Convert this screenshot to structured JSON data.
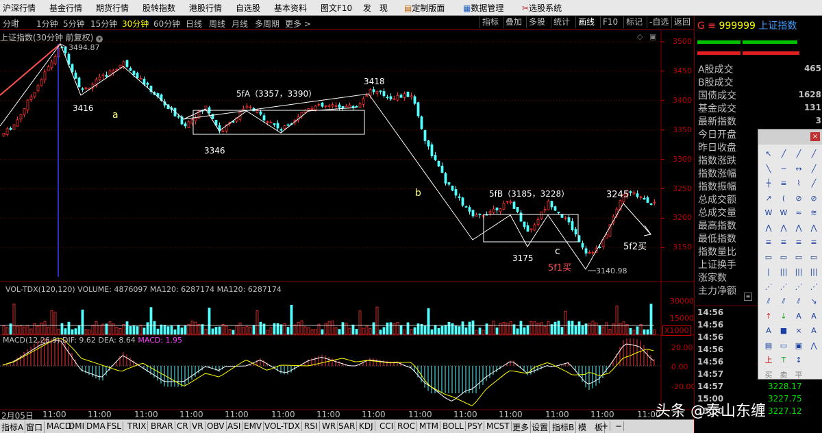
{
  "menu": [
    "沪深行情",
    "基金行情",
    "期货行情",
    "股转指数",
    "港股行情",
    "自选股",
    "基本资料",
    "图文F10",
    "发　现",
    "定制版面",
    "数据管理",
    "选股系统"
  ],
  "toolbar": {
    "periods": [
      "分时",
      "1分钟",
      "5分钟",
      "15分钟",
      "30分钟",
      "60分钟",
      "日线",
      "周线",
      "月线",
      "多周期",
      "更多 >"
    ],
    "active_period": "30分钟",
    "right_buttons": [
      "指标",
      "叠加",
      "多股",
      "统计",
      "画线",
      "F10",
      "标记",
      "-自选",
      "返回"
    ],
    "active_right": "画线"
  },
  "chart": {
    "title": "上证指数(30分钟 前复权)",
    "price_axis": [
      "3500",
      "3450",
      "3400",
      "3350",
      "3300",
      "3250",
      "3200",
      "3150"
    ],
    "annotations": {
      "high_label": "3494.87",
      "low1": "3416",
      "a": "a",
      "fa": "5fA（3357，3390）",
      "low2": "3346",
      "peak": "3418",
      "b": "b",
      "fb": "5fB（3185，3228）",
      "low3": "3175",
      "c": "c",
      "buy1": "5f1买",
      "low_label": "3140.98",
      "peak2": "3245",
      "buy2": "5f2买"
    },
    "vol_title": "VOL-TDX(120,120)  VOLUME: 4876097  MA120: 6287174  MA120: 6287174",
    "vol_axis": [
      "30000",
      "15000",
      "X1000"
    ],
    "macd_title": "MACD(12,26,9)  DIF: 9.62  DEA: 8.64",
    "macd_value": "MACD: 1.95",
    "macd_axis": [
      "20.00",
      "0.00",
      "-20.00"
    ],
    "time_axis": [
      "2月05日",
      "11:00",
      "11:00",
      "11:00",
      "11:00",
      "11:00",
      "11:00",
      "11:00",
      "11:00",
      "11:00",
      "11:00",
      "11:00",
      "11:00",
      "11:00",
      "11:00",
      "11:00",
      "11:00",
      "11:00"
    ]
  },
  "right_panel": {
    "code_prefix": "G ≡",
    "code": "999999",
    "name": "上证指数",
    "rows": [
      {
        "label": "A股成交",
        "value": "465"
      },
      {
        "label": "B股成交",
        "value": ""
      },
      {
        "label": "国债成交",
        "value": "1628"
      },
      {
        "label": "基金成交",
        "value": "131"
      },
      {
        "label": "最新指数",
        "value": "3"
      },
      {
        "label": "今日开盘",
        "value": ""
      },
      {
        "label": "昨日收盘",
        "value": ""
      },
      {
        "label": "指数涨跌",
        "value": ""
      },
      {
        "label": "指数涨幅",
        "value": ""
      },
      {
        "label": "指数振幅",
        "value": ""
      },
      {
        "label": "总成交额",
        "value": ""
      },
      {
        "label": "总成交量",
        "value": ""
      },
      {
        "label": "最高指数",
        "value": ""
      },
      {
        "label": "最低指数",
        "value": ""
      },
      {
        "label": "指数量比",
        "value": ""
      },
      {
        "label": "上证换手",
        "value": ""
      },
      {
        "label": "涨家数",
        "value": ""
      },
      {
        "label": "主力净额",
        "value": ""
      }
    ],
    "ticks": [
      {
        "time": "14:56",
        "value": "3"
      },
      {
        "time": "14:56",
        "value": "3"
      },
      {
        "time": "14:56",
        "value": "3"
      },
      {
        "time": "14:56",
        "value": "3"
      },
      {
        "time": "14:56",
        "value": "3"
      },
      {
        "time": "14:57",
        "value": "3"
      },
      {
        "time": "14:57",
        "value": "3228.17"
      },
      {
        "time": "15:00",
        "value": "3227.75"
      },
      {
        "time": "15:00",
        "value": "3227.12"
      }
    ]
  },
  "bottom_tabs": [
    "指标A",
    "窗口",
    "MACD",
    "DMI",
    "DMA",
    "FSL",
    "TRIX",
    "BRAR",
    "CR",
    "VR",
    "OBV",
    "ASI",
    "EMV",
    "VOL-TDX",
    "RSI",
    "WR",
    "SAR",
    "KDJ",
    "CCI",
    "ROC",
    "MTM",
    "BOLL",
    "PSY",
    "MCST",
    "更多",
    "设置",
    "指标B",
    "模　板",
    "+",
    "−"
  ],
  "watermark": "头条 @泰山东缠",
  "colors": {
    "up": "#ff3232",
    "down": "#54ffff",
    "grid": "#800000",
    "annotation": "#ffffff",
    "label_yellow": "#ffff80",
    "dif": "#ffffff",
    "dea": "#ffff00",
    "buy": "#ff5050"
  }
}
